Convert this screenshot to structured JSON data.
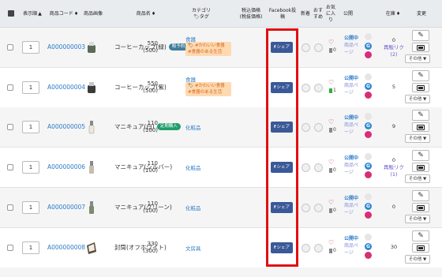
{
  "headers": {
    "order": "表示順",
    "code": "商品コード",
    "image": "商品画像",
    "name": "商品名",
    "category": "カテゴリ",
    "tag": "タグ",
    "price": "税込価格",
    "price_sub": "(税抜価格)",
    "facebook": "Facebook投稿",
    "new": "新着",
    "recommend": "おすすめ",
    "favorite": "お気に入り",
    "publish": "公開",
    "stock": "在庫",
    "change": "変更"
  },
  "sort_glyph": "♦",
  "rows": [
    {
      "order": "1",
      "code": "A000000003",
      "name": "コーヒーカップ(緑)",
      "badge": "販予約",
      "category": "食器",
      "tags": [
        "#かわいい食器",
        "#食器のある生活"
      ],
      "price": "550",
      "price_ex": "(500)",
      "share": "シェア",
      "fav": "0",
      "flag_green": false,
      "publish": "公開中",
      "page": "商品ページ",
      "stock": "0",
      "stock_note": "再販リク(2)",
      "more": "その他"
    },
    {
      "order": "1",
      "code": "A000000004",
      "name": "コーヒーカップ(紫)",
      "badge": "",
      "category": "食器",
      "tags": [
        "#かわいい食器",
        "#食器のある生活"
      ],
      "price": "550",
      "price_ex": "(500)",
      "share": "シェア",
      "fav": "1",
      "flag_green": true,
      "publish": "公開中",
      "page": "商品ページ",
      "stock": "5",
      "stock_note": "",
      "more": "その他"
    },
    {
      "order": "1",
      "code": "A000000005",
      "name": "マニキュア(白)",
      "badge": "定期購入",
      "category": "化粧品",
      "tags": [],
      "price": "110",
      "price_ex": "(100)",
      "share": "シェア",
      "fav": "0",
      "flag_green": false,
      "publish": "公開中",
      "page": "商品ページ",
      "stock": "9",
      "stock_note": "",
      "more": "その他"
    },
    {
      "order": "1",
      "code": "A000000006",
      "name": "マニキュア(シルバー)",
      "badge": "",
      "category": "化粧品",
      "tags": [],
      "price": "110",
      "price_ex": "(100)",
      "share": "シェア",
      "fav": "0",
      "flag_green": false,
      "publish": "公開中",
      "page": "商品ページ",
      "stock": "0",
      "stock_note": "再販リク(1)",
      "more": "その他"
    },
    {
      "order": "1",
      "code": "A000000007",
      "name": "マニキュア(グリーン)",
      "badge": "",
      "category": "化粧品",
      "tags": [],
      "price": "110",
      "price_ex": "(100)",
      "share": "シェア",
      "fav": "0",
      "flag_green": false,
      "publish": "公開中",
      "page": "商品ページ",
      "stock": "0",
      "stock_note": "",
      "more": "その他"
    },
    {
      "order": "1",
      "code": "A000000008",
      "name": "封筒(オフホワイト)",
      "badge": "",
      "category": "文房具",
      "tags": [],
      "price": "330",
      "price_ex": "(300)",
      "share": "シェア",
      "fav": "0",
      "flag_green": false,
      "publish": "公開中",
      "page": "商品ページ",
      "stock": "30",
      "stock_note": "",
      "more": "その他"
    }
  ],
  "colors": {
    "link": "#2d7cc9",
    "facebook": "#3b5998",
    "highlight": "#e01010",
    "tag_bg": "#ffd9b0"
  },
  "icons": {
    "edit": "pencil-icon",
    "image": "image-icon",
    "share": "facebook-icon",
    "heart": "heart-icon",
    "flag": "flag-icon",
    "google": "google-icon",
    "instagram": "instagram-icon",
    "tag": "tag-icon"
  }
}
